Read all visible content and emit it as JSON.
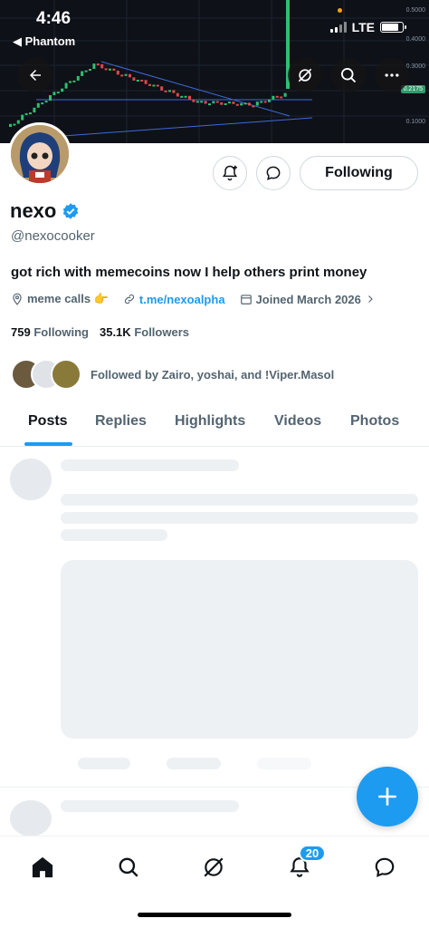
{
  "status_bar": {
    "time": "4:46",
    "back_app": "◀ Phantom",
    "network": "LTE"
  },
  "banner": {
    "price_ticks": [
      "0.5000",
      "0.4000",
      "0.3000",
      "0.1000"
    ],
    "current_price": "0.2175",
    "buttons": [
      "back-arrow",
      "crypto-slash",
      "search",
      "more"
    ]
  },
  "profile": {
    "display_name": "nexo",
    "verified": true,
    "handle": "@nexocooker",
    "bio": "got rich with memecoins now I help others print money",
    "location": "meme calls 👉",
    "link": "t.me/nexoalpha",
    "joined": "Joined March 2026",
    "following_count": "759",
    "following_label": "Following",
    "followers_count": "35.1K",
    "followers_label": "Followers",
    "followed_by": "Followed by Zairo, yoshai, and !Viper.Masol"
  },
  "actions": {
    "follow_button": "Following",
    "notify_icon": "bell-plus-icon",
    "message_icon": "chat-bubble-icon"
  },
  "tabs": [
    {
      "label": "Posts",
      "active": true
    },
    {
      "label": "Replies",
      "active": false
    },
    {
      "label": "Highlights",
      "active": false
    },
    {
      "label": "Videos",
      "active": false
    },
    {
      "label": "Photos",
      "active": false
    }
  ],
  "bottom_nav": {
    "items": [
      "home-icon",
      "search-icon",
      "grok-icon",
      "bell-icon",
      "messages-icon"
    ],
    "notifications_badge": "20"
  },
  "colors": {
    "accent": "#1d9bf0",
    "text": "#0f1419",
    "secondary_text": "#536471"
  }
}
